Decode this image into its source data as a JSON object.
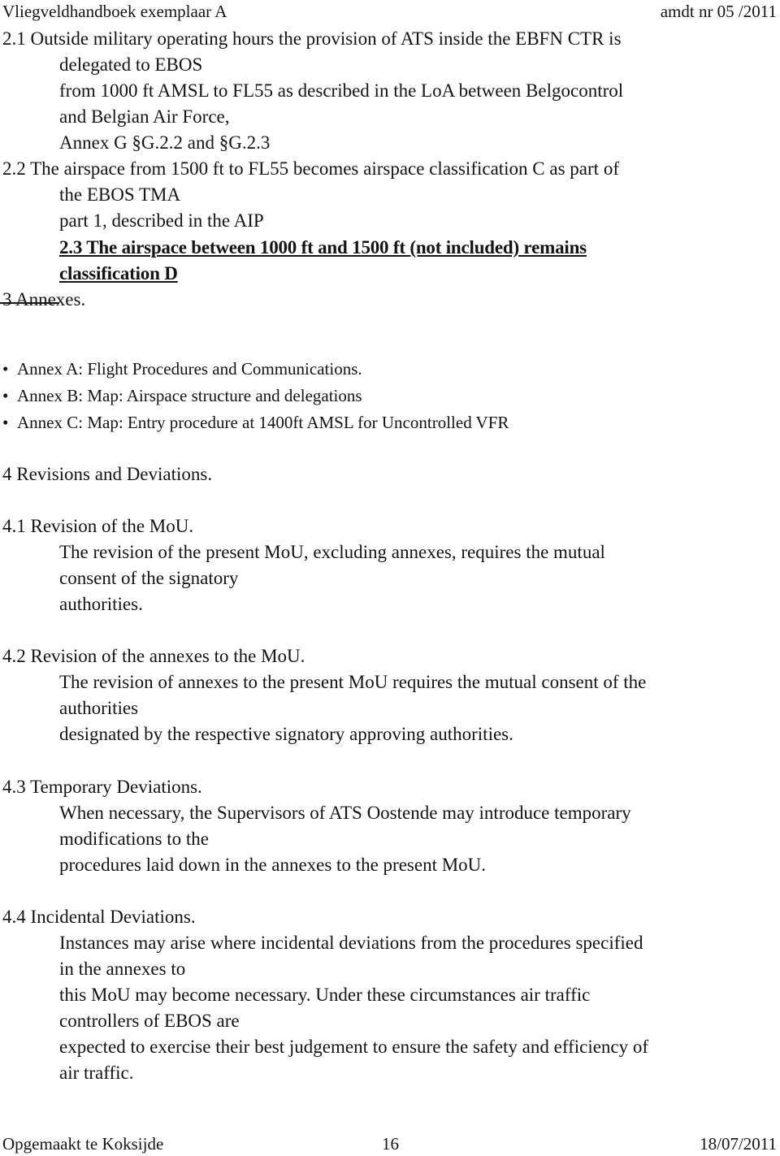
{
  "header": {
    "left": "Vliegveldhandboek exemplaar A",
    "right": "amdt nr 05 /2011"
  },
  "section2": {
    "p21": [
      "2.1 Outside military operating hours the provision of ATS inside the EBFN CTR is",
      "delegated to EBOS",
      "from 1000 ft AMSL to FL55 as described in the LoA between Belgocontrol",
      "and Belgian Air Force,",
      "Annex G §G.2.2 and §G.2.3"
    ],
    "p22": [
      "2.2 The airspace from 1500 ft to FL55 becomes airspace classification C as part of",
      "the EBOS TMA",
      "part 1, described in the AIP"
    ],
    "p23": [
      "2.3 The airspace between 1000 ft and 1500 ft (not included) remains",
      "classification D"
    ]
  },
  "section3": {
    "heading": "3 Annexes.",
    "bullet_glyph": "•",
    "items": [
      "Annex A: Flight Procedures and Communications.",
      "Annex B: Map: Airspace structure and delegations",
      "Annex C: Map: Entry procedure at 1400ft AMSL for Uncontrolled VFR"
    ]
  },
  "section4": {
    "heading": "4 Revisions and Deviations.",
    "subsections": [
      {
        "title": "4.1 Revision of the MoU.",
        "lines": [
          "The revision of the present MoU, excluding annexes, requires the mutual",
          "consent of the signatory",
          "authorities."
        ]
      },
      {
        "title": "4.2 Revision of the annexes to the MoU.",
        "lines": [
          "The revision of annexes to the present MoU requires the mutual consent of the",
          "authorities",
          "designated by the respective signatory approving authorities."
        ]
      },
      {
        "title": "4.3 Temporary Deviations.",
        "lines": [
          "When necessary, the Supervisors of ATS Oostende may introduce temporary",
          "modifications to the",
          "procedures laid down in the annexes to the present MoU."
        ]
      },
      {
        "title": "4.4 Incidental Deviations.",
        "lines": [
          "Instances may arise where incidental deviations from the procedures specified",
          "in the annexes to",
          "this MoU may become necessary. Under these circumstances air traffic",
          "controllers of EBOS are",
          "expected to exercise their best judgement to ensure the safety and efficiency of",
          "air traffic."
        ]
      }
    ]
  },
  "footer": {
    "left": "Opgemaakt te Koksijde",
    "center": "16",
    "right": "18/07/2011"
  }
}
